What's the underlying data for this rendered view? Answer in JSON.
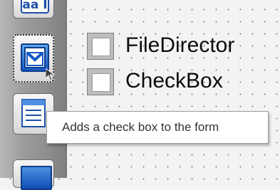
{
  "toolbox": {
    "tools": [
      {
        "name": "label-tool",
        "icon": "label-aa-icon",
        "glyph": "aa I"
      },
      {
        "name": "checkbox-tool",
        "icon": "checkbox-tool-icon",
        "selected": true
      },
      {
        "name": "list-tool",
        "icon": "list-icon"
      },
      {
        "name": "image-tool",
        "icon": "image-icon"
      }
    ]
  },
  "canvas": {
    "items": [
      {
        "label": "FileDirector"
      },
      {
        "label": "CheckBox"
      }
    ]
  },
  "tooltip": {
    "text": "Adds a check box to the form"
  },
  "colors": {
    "accent_blue": "#1659c4",
    "canvas_bg": "#f3f3f3"
  }
}
